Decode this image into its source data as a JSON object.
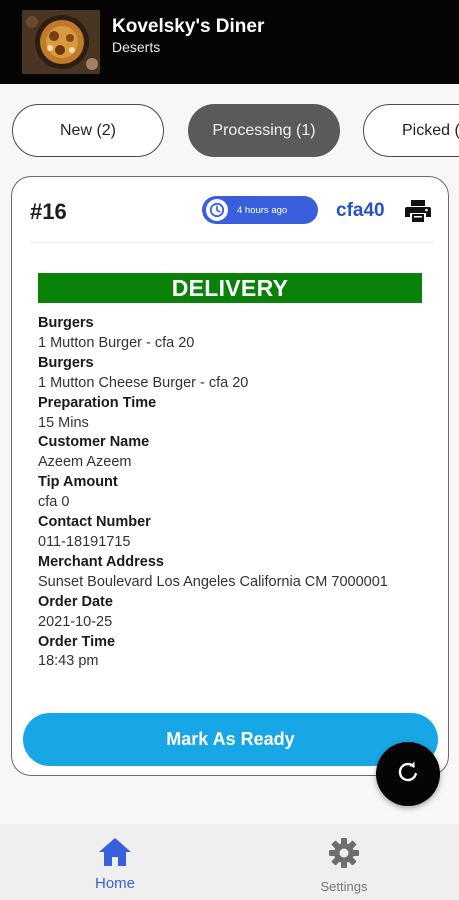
{
  "header": {
    "title": "Kovelsky's Diner",
    "subtitle": "Deserts",
    "logo_icon": "food-plate-logo"
  },
  "tabs": [
    {
      "label": "New (2)",
      "active": false
    },
    {
      "label": "Processing (1)",
      "active": true
    },
    {
      "label": "Picked (",
      "active": false
    }
  ],
  "order": {
    "id": "#16",
    "time_ago": "4 hours ago",
    "amount": "cfa40",
    "type_banner": "DELIVERY",
    "fields": [
      {
        "label": "Burgers",
        "value": "1 Mutton Burger - cfa 20"
      },
      {
        "label": "Burgers",
        "value": "1 Mutton Cheese Burger - cfa 20"
      },
      {
        "label": "Preparation Time",
        "value": "15 Mins"
      },
      {
        "label": "Customer Name",
        "value": "Azeem Azeem"
      },
      {
        "label": "Tip Amount",
        "value": "cfa 0"
      },
      {
        "label": "Contact Number",
        "value": "011-18191715"
      },
      {
        "label": "Merchant Address",
        "value": "Sunset Boulevard Los Angeles California CM 7000001"
      },
      {
        "label": "Order Date",
        "value": "2021-10-25"
      },
      {
        "label": "Order Time",
        "value": "18:43 pm"
      }
    ],
    "action_label": "Mark As Ready"
  },
  "bottom_nav": {
    "home_label": "Home",
    "settings_label": "Settings"
  },
  "colors": {
    "accent_blue": "#3a5fdc",
    "delivery_green": "#0a820a",
    "ready_button": "#18a7e6",
    "header_bg": "#050505"
  }
}
